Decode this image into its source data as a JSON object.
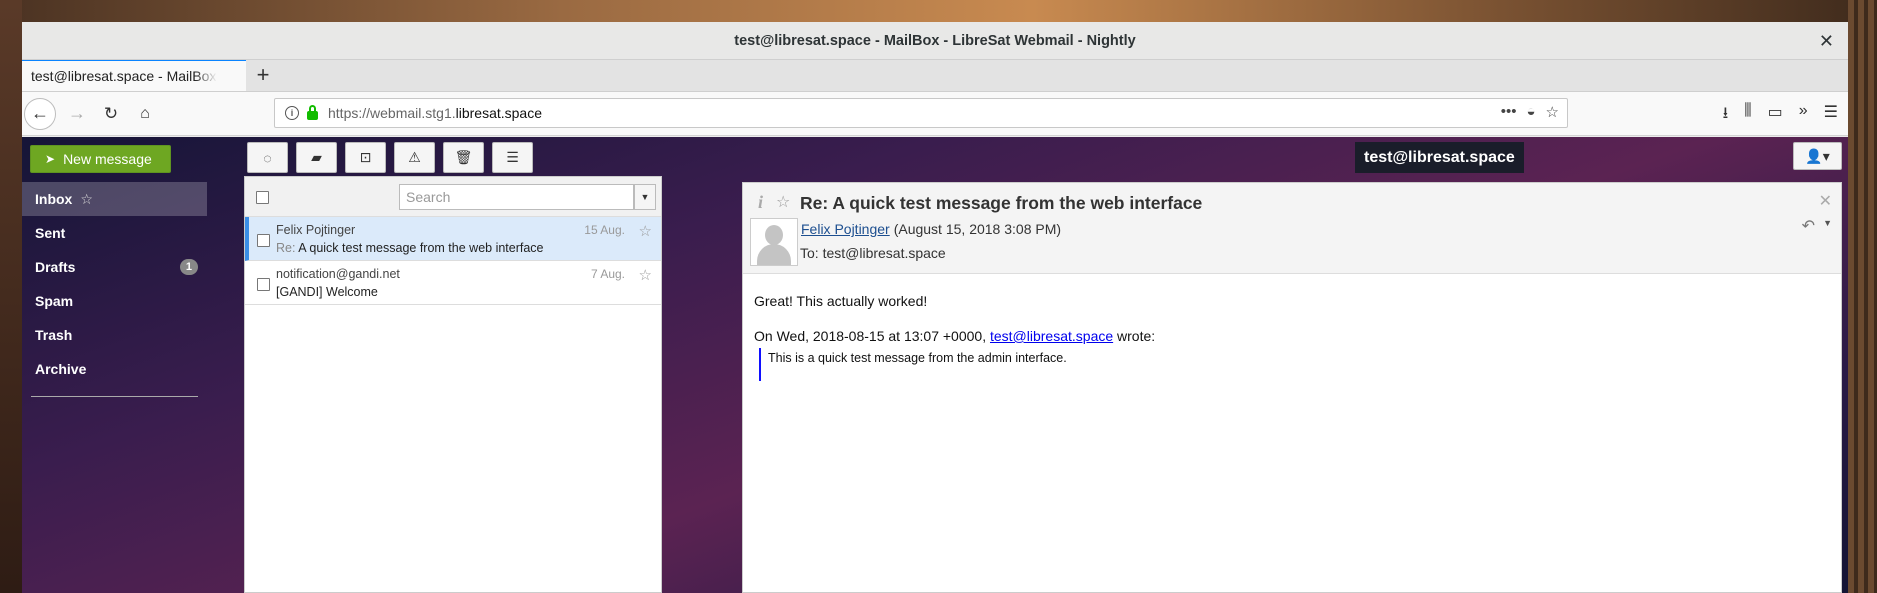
{
  "window": {
    "title": "test@libresat.space - MailBox - LibreSat Webmail - Nightly"
  },
  "browser": {
    "tab_label": "test@libresat.space - MailBox - LibreSat Webmail - Nightly",
    "url_prefix": "https://webmail.stg1.",
    "url_domain": "libresat.space",
    "accent_color": "#0a84ff",
    "secure_color": "#12bc00"
  },
  "toolbar": {
    "compose_label": "New message",
    "compose_color": "#6ea722",
    "tools": [
      "refresh-icon",
      "move-folder-icon",
      "archive-icon",
      "spam-icon",
      "delete-icon",
      "more-icon"
    ],
    "account": "test@libresat.space"
  },
  "folders": {
    "items": [
      {
        "label": "Inbox",
        "active": true
      },
      {
        "label": "Sent"
      },
      {
        "label": "Drafts",
        "count": "1"
      },
      {
        "label": "Spam"
      },
      {
        "label": "Trash"
      },
      {
        "label": "Archive"
      }
    ]
  },
  "list": {
    "search_placeholder": "Search",
    "messages": [
      {
        "from": "Felix Pojtinger",
        "re": "Re:",
        "subject": "A quick test message from the web interface",
        "date": "15 Aug.",
        "selected": true
      },
      {
        "from": "notification@gandi.net",
        "subject": "[GANDI] Welcome",
        "date": "7 Aug."
      }
    ]
  },
  "reader": {
    "info_glyph": "i",
    "subject": "Re: A quick test message from the web interface",
    "from_name": "Felix Pojtinger",
    "date": "(August 15, 2018 3:08 PM)",
    "to": "To: test@libresat.space",
    "body_line": "Great! This actually worked!",
    "quote_prefix": "On Wed, 2018-08-15 at 13:07 +0000,",
    "quote_link": "test@libresat.space",
    "quote_suffix": "wrote:",
    "quote_text": "This is a quick test message from the admin interface."
  }
}
